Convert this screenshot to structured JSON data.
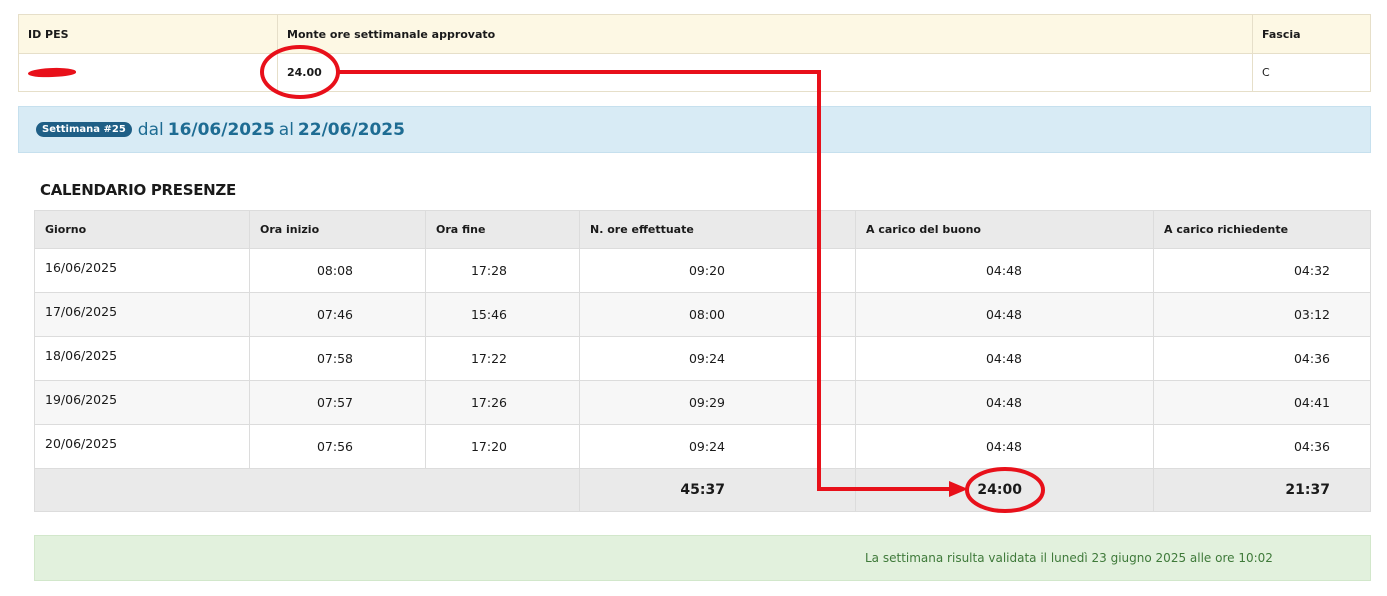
{
  "pes_header": {
    "col_id": "ID PES",
    "col_monte": "Monte ore settimanale approvato",
    "col_fascia": "Fascia"
  },
  "pes_row": {
    "monte_ore": "24.00",
    "fascia": "C"
  },
  "week": {
    "badge": "Settimana #25",
    "dal_label": "dal",
    "start_date": "16/06/2025",
    "al_label": "al",
    "end_date": "22/06/2025"
  },
  "calendar": {
    "title": "CALENDARIO PRESENZE",
    "headers": [
      "Giorno",
      "Ora inizio",
      "Ora fine",
      "N. ore effettuate",
      "A carico del buono",
      "A carico richiedente"
    ],
    "rows": [
      [
        "16/06/2025",
        "08:08",
        "17:28",
        "09:20",
        "04:48",
        "04:32"
      ],
      [
        "17/06/2025",
        "07:46",
        "15:46",
        "08:00",
        "04:48",
        "03:12"
      ],
      [
        "18/06/2025",
        "07:58",
        "17:22",
        "09:24",
        "04:48",
        "04:36"
      ],
      [
        "19/06/2025",
        "07:57",
        "17:26",
        "09:29",
        "04:48",
        "04:41"
      ],
      [
        "20/06/2025",
        "07:56",
        "17:20",
        "09:24",
        "04:48",
        "04:36"
      ]
    ],
    "totals": {
      "ore_effettuate": "45:37",
      "carico_buono": "24:00",
      "carico_richiedente": "21:37"
    }
  },
  "validation_message": "La settimana risulta validata il lunedì 23 giugno 2025 alle ore 10:02",
  "annotation": {
    "color": "#e8101a"
  }
}
